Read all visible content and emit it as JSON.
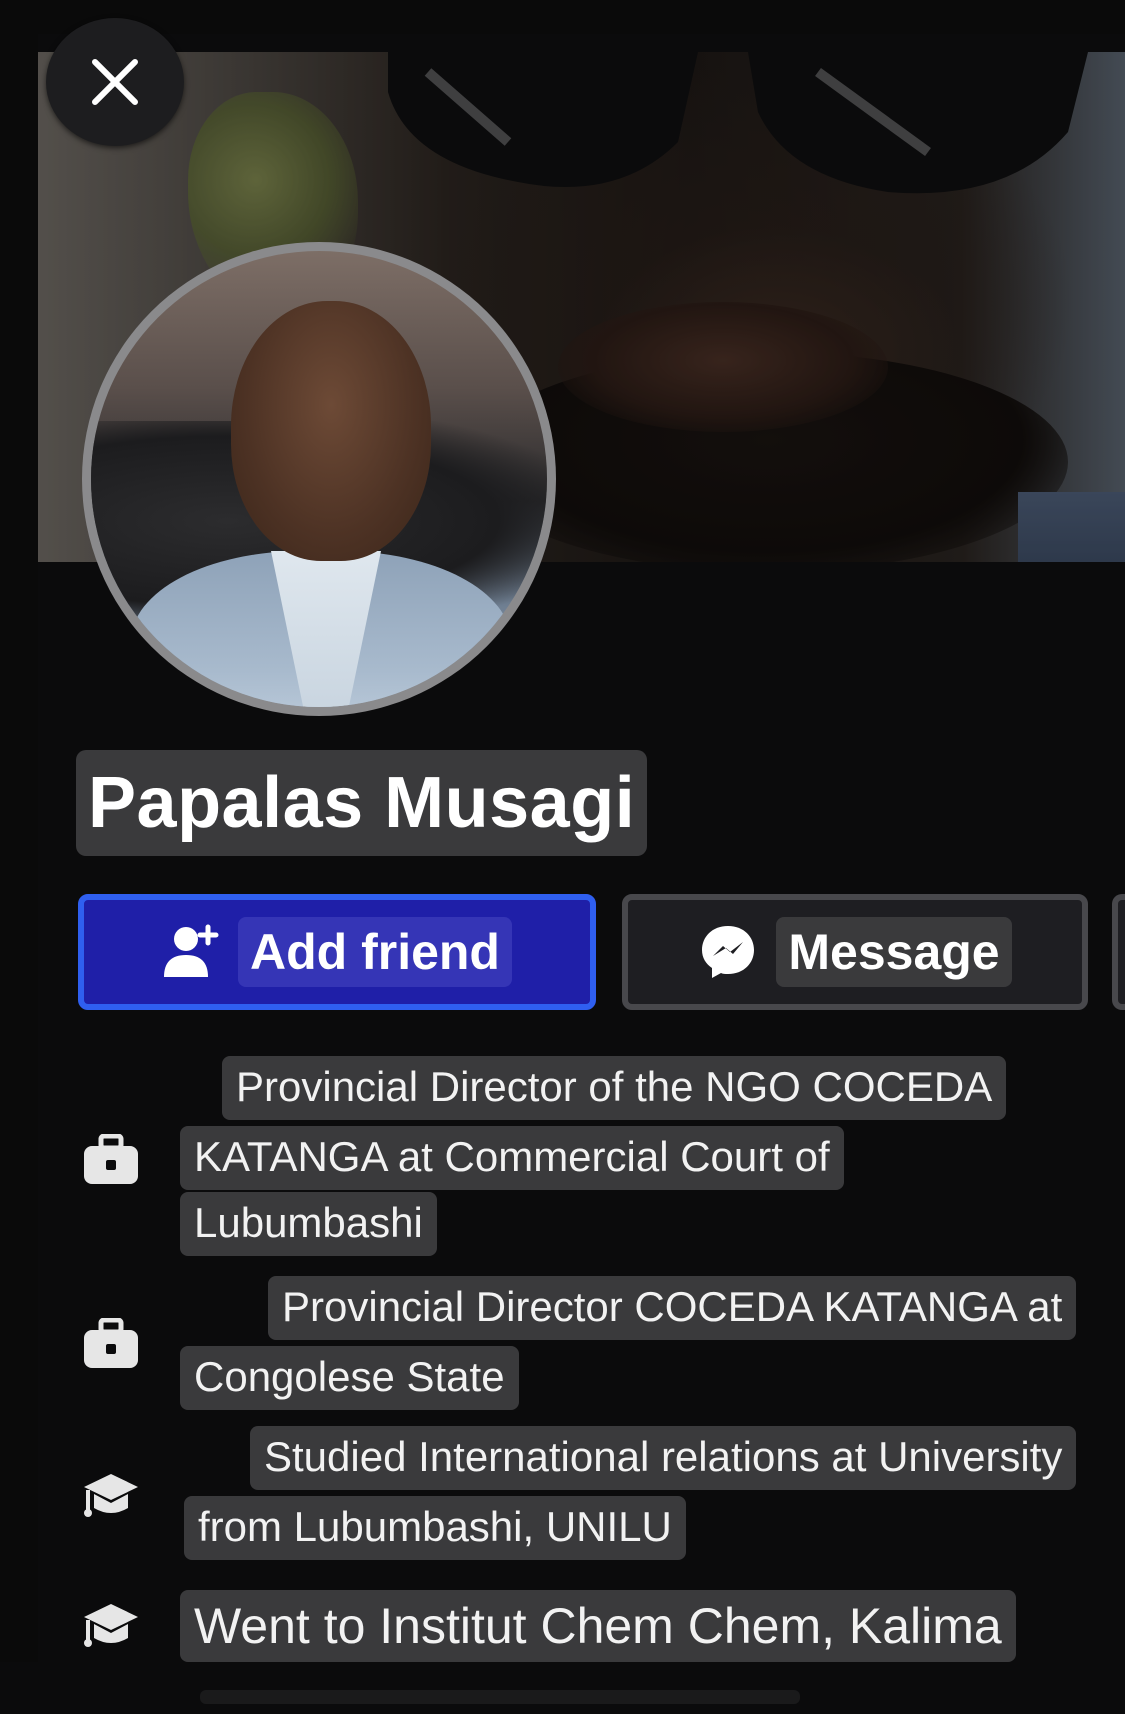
{
  "profile": {
    "name": "Papalas Musagi"
  },
  "actions": {
    "add_friend_label": "Add friend",
    "message_label": "Message"
  },
  "icons": {
    "close": "close-icon",
    "add_friend": "add-person-icon",
    "message": "messenger-icon",
    "work": "briefcase-icon",
    "education": "graduation-cap-icon"
  },
  "colors": {
    "add_friend_bg": "#1f1fa8",
    "add_friend_border": "#2f5ff0",
    "message_bg": "#1e1e22",
    "background": "#0b0b0c",
    "pill_bg": "#3a3a3c"
  },
  "intro": {
    "work1": {
      "line1": "Provincial Director of the NGO COCEDA",
      "line2": " KATANGA at Commercial Court of",
      "line3": "Lubumbashi"
    },
    "work2": {
      "line1": "Provincial Director COCEDA KATANGA at",
      "line2": "Congolese State"
    },
    "edu1": {
      "line1": "Studied International relations at University",
      "line2": "from Lubumbashi, UNILU"
    },
    "edu2": {
      "line1": "Went to Institut Chem Chem, Kalima"
    }
  }
}
